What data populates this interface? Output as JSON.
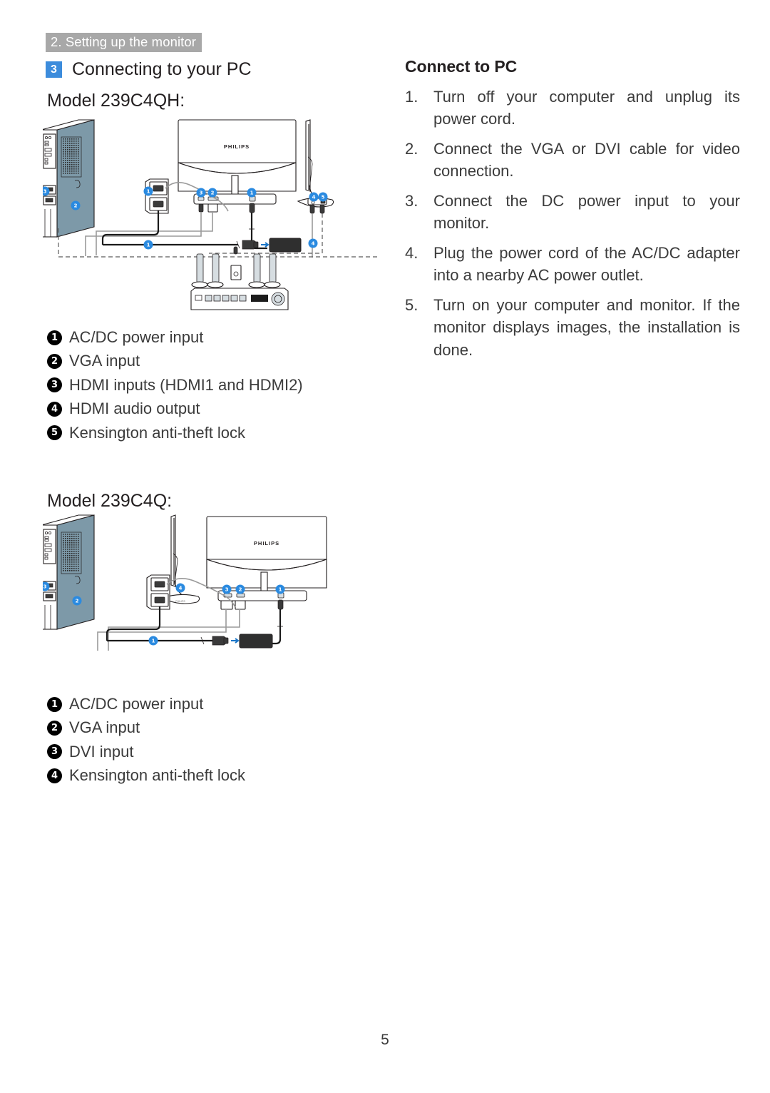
{
  "header": {
    "chapter": "2. Setting up the monitor",
    "section_number": "3",
    "section_title": "Connecting to your PC"
  },
  "models": {
    "model1_label": "Model 239C4QH:",
    "model2_label": "Model 239C4Q:"
  },
  "legend_qh": [
    {
      "num": "1",
      "label": "AC/DC power input"
    },
    {
      "num": "2",
      "label": "VGA input"
    },
    {
      "num": "3",
      "label": "HDMI inputs (HDMI1 and HDMI2)"
    },
    {
      "num": "4",
      "label": "HDMI audio output"
    },
    {
      "num": "5",
      "label": "Kensington anti-theft lock"
    }
  ],
  "legend_q": [
    {
      "num": "1",
      "label": "AC/DC power input"
    },
    {
      "num": "2",
      "label": "VGA input"
    },
    {
      "num": "3",
      "label": "DVI input"
    },
    {
      "num": "4",
      "label": "Kensington anti-theft lock"
    }
  ],
  "connect_to_pc": {
    "heading": "Connect to PC",
    "steps": [
      {
        "num": "1.",
        "text": "Turn off your computer and unplug its power cord."
      },
      {
        "num": "2.",
        "text": "Connect the VGA or DVI cable for video connection."
      },
      {
        "num": "3.",
        "text": "Connect the DC power input to your monitor."
      },
      {
        "num": "4.",
        "text": "Plug the power cord of the AC/DC adapter into a nearby AC power outlet."
      },
      {
        "num": "5.",
        "text": "Turn on your computer and monitor. If the monitor displays images, the installation is done."
      }
    ]
  },
  "figures": {
    "brand_logo": "PHILIPS",
    "fig1_callouts": [
      "1",
      "2",
      "3",
      "4",
      "5"
    ],
    "fig2_callouts": [
      "1",
      "2",
      "3",
      "4"
    ]
  },
  "footer": {
    "page_number": "5"
  },
  "colors": {
    "accent_blue": "#3c8cdc",
    "chapter_gray": "#a8a8a8",
    "body_text": "#3b3b3b",
    "tower_side": "#7d99a8"
  }
}
